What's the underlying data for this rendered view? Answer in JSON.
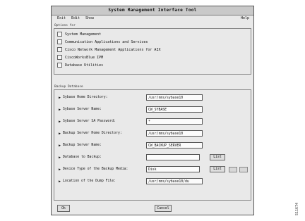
{
  "window": {
    "title": "System Management Interface Tool"
  },
  "menu": {
    "exit": "Exit",
    "edit": "Edit",
    "show": "Show",
    "help": "Help"
  },
  "options": {
    "section_label": "Options for",
    "items": [
      "System Management",
      "Communication Applications and Services",
      "Cisco Network Management Applications for AIX",
      "CiscoWorksBlue IPM",
      "Database Utilities"
    ]
  },
  "backup": {
    "section_label": "Backup Database",
    "fields": [
      {
        "label": "Sybase Home Directory:",
        "value": "/usr/nms/sybase10"
      },
      {
        "label": "Sybase Server Name:",
        "value": "CW_SYBASE"
      },
      {
        "label": "Sybase Server SA Password:",
        "value": "*"
      },
      {
        "label": "Backup Server Home Directory:",
        "value": "/usr/nms/sybase10"
      },
      {
        "label": "Backup Server Name:",
        "value": "CW_BACKUP_SERVER"
      },
      {
        "label": "Database to Backup:",
        "value": ""
      },
      {
        "label": "Device Type of the Backup Media:",
        "value": "Disk"
      },
      {
        "label": "Location of the Dump File:",
        "value": "/usr/nms/sybase10/du"
      }
    ],
    "list_label": "List"
  },
  "footer": {
    "ok": "Ok",
    "cancel": "Cancel"
  },
  "figure_id": "S11674"
}
